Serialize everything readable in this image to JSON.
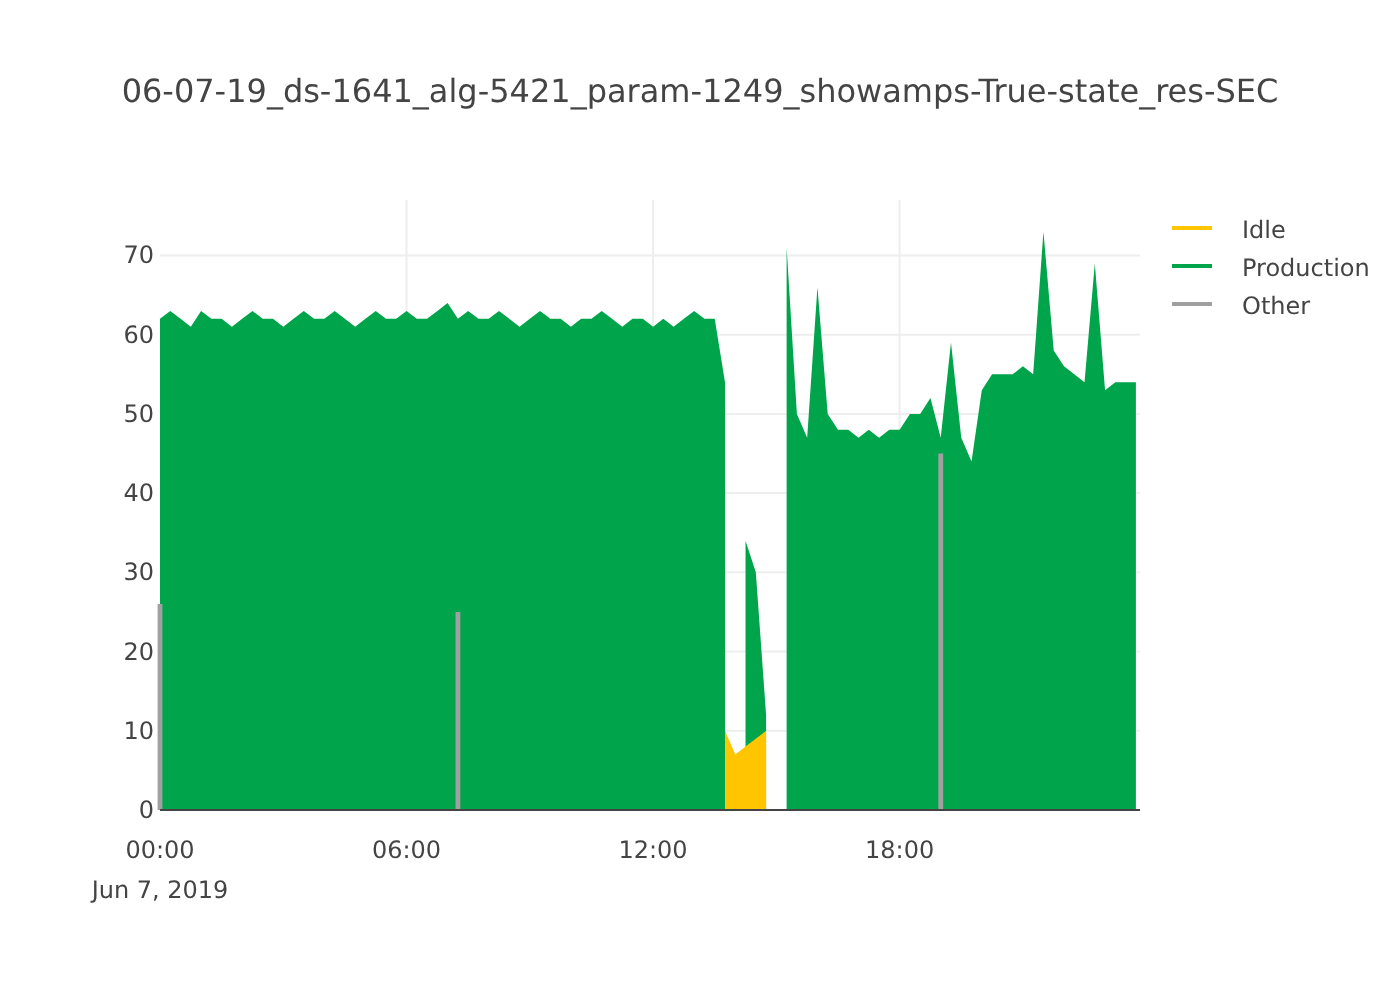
{
  "chart_data": {
    "type": "area",
    "title": "06-07-19_ds-1641_alg-5421_param-1249_showamps-True-state_res-SEC",
    "x": [
      0,
      0.25,
      0.5,
      0.75,
      1,
      1.25,
      1.5,
      1.75,
      2,
      2.25,
      2.5,
      2.75,
      3,
      3.25,
      3.5,
      3.75,
      4,
      4.25,
      4.5,
      4.75,
      5,
      5.25,
      5.5,
      5.75,
      6,
      6.25,
      6.5,
      6.75,
      7,
      7.25,
      7.5,
      7.75,
      8,
      8.25,
      8.5,
      8.75,
      9,
      9.25,
      9.5,
      9.75,
      10,
      10.25,
      10.5,
      10.75,
      11,
      11.25,
      11.5,
      11.75,
      12,
      12.25,
      12.5,
      12.75,
      13,
      13.25,
      13.5,
      13.75,
      14,
      14.25,
      14.5,
      14.75,
      15,
      15.25,
      15.5,
      15.75,
      16,
      16.25,
      16.5,
      16.75,
      17,
      17.25,
      17.5,
      17.75,
      18,
      18.25,
      18.5,
      18.75,
      19,
      19.25,
      19.5,
      19.75,
      20,
      20.25,
      20.5,
      20.75,
      21,
      21.25,
      21.5,
      21.75,
      22,
      22.25,
      22.5,
      22.75,
      23,
      23.25,
      23.5,
      23.75
    ],
    "series": [
      {
        "name": "Idle",
        "color": "#ffc600",
        "values": [
          null,
          null,
          null,
          null,
          null,
          null,
          null,
          null,
          null,
          null,
          null,
          null,
          null,
          null,
          null,
          null,
          null,
          null,
          null,
          null,
          null,
          null,
          null,
          null,
          null,
          null,
          null,
          null,
          null,
          null,
          null,
          null,
          null,
          null,
          null,
          null,
          null,
          null,
          null,
          null,
          null,
          null,
          null,
          null,
          null,
          null,
          null,
          null,
          null,
          null,
          null,
          null,
          null,
          null,
          null,
          10,
          7,
          8,
          9,
          10,
          null,
          null,
          null,
          null,
          null,
          null,
          null,
          null,
          null,
          null,
          null,
          null,
          null,
          null,
          null,
          null,
          null,
          null,
          null,
          null,
          null,
          null,
          null,
          null,
          null,
          null,
          null,
          null,
          null,
          null,
          null,
          null,
          null,
          null,
          null,
          null
        ]
      },
      {
        "name": "Production",
        "color": "#00a44a",
        "values": [
          62,
          63,
          62,
          61,
          63,
          62,
          62,
          61,
          62,
          63,
          62,
          62,
          61,
          62,
          63,
          62,
          62,
          63,
          62,
          61,
          62,
          63,
          62,
          62,
          63,
          62,
          62,
          63,
          64,
          62,
          63,
          62,
          62,
          63,
          62,
          61,
          62,
          63,
          62,
          62,
          61,
          62,
          62,
          63,
          62,
          61,
          62,
          62,
          61,
          62,
          61,
          62,
          63,
          62,
          62,
          54,
          null,
          34,
          30,
          12,
          null,
          71,
          50,
          47,
          66,
          50,
          48,
          48,
          47,
          48,
          47,
          48,
          48,
          50,
          50,
          52,
          47,
          59,
          47,
          44,
          53,
          55,
          55,
          55,
          56,
          55,
          73,
          58,
          56,
          55,
          54,
          69,
          53,
          54,
          54,
          54
        ]
      },
      {
        "name": "Other",
        "color": "#a0a0a0",
        "values": [
          26,
          null,
          null,
          null,
          null,
          null,
          null,
          null,
          null,
          null,
          null,
          null,
          null,
          null,
          null,
          null,
          null,
          null,
          null,
          null,
          null,
          null,
          null,
          null,
          null,
          null,
          null,
          null,
          null,
          25,
          null,
          null,
          null,
          null,
          null,
          null,
          null,
          null,
          null,
          null,
          null,
          null,
          null,
          null,
          null,
          null,
          null,
          null,
          null,
          null,
          null,
          null,
          null,
          null,
          null,
          null,
          null,
          null,
          null,
          null,
          null,
          null,
          null,
          null,
          null,
          null,
          null,
          null,
          null,
          null,
          null,
          null,
          null,
          null,
          null,
          null,
          45,
          null,
          null,
          null,
          null,
          null,
          null,
          null,
          null,
          null,
          null,
          null,
          null,
          null,
          null,
          null,
          null,
          null,
          null,
          null
        ]
      }
    ],
    "xlim": [
      0,
      23.85
    ],
    "ylim": [
      0,
      77
    ],
    "xticks": [
      {
        "value": 0,
        "label": "00:00"
      },
      {
        "value": 6,
        "label": "06:00"
      },
      {
        "value": 12,
        "label": "12:00"
      },
      {
        "value": 18,
        "label": "18:00"
      }
    ],
    "annotations": [
      "Jun 7, 2019"
    ],
    "grid": true,
    "legend": true,
    "yticks": [
      0,
      10,
      20,
      30,
      40,
      50,
      60,
      70
    ]
  }
}
